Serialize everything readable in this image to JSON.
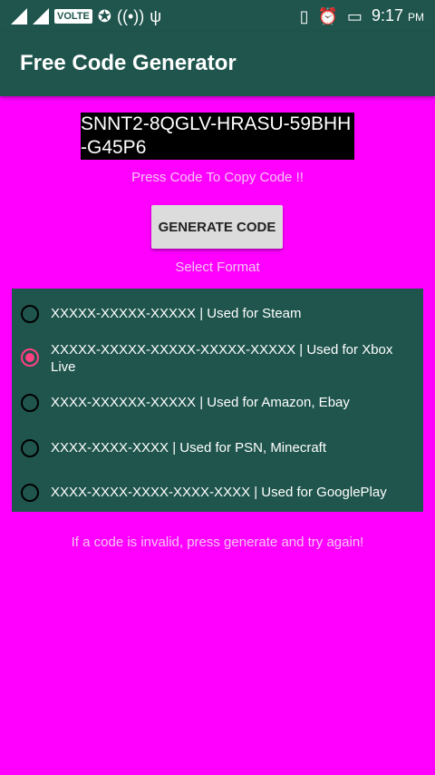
{
  "status_bar": {
    "volte": "VOLTE",
    "time": "9:17",
    "ampm": "PM",
    "icons": [
      "signal-icon",
      "signal-icon",
      "volte-icon",
      "messenger-icon",
      "hotspot-icon",
      "usb-icon",
      "vibrate-icon",
      "alarm-icon",
      "battery-icon"
    ]
  },
  "app": {
    "title": "Free Code Generator"
  },
  "code": {
    "value": "SNNT2-8QGLV-HRASU-59BHH-G45P6",
    "copy_hint": "Press Code To Copy Code !!"
  },
  "generate": {
    "label": "GENERATE CODE"
  },
  "format": {
    "label": "Select Format",
    "selected_index": 1,
    "options": [
      {
        "label": "XXXXX-XXXXX-XXXXX | Used for Steam"
      },
      {
        "label": "XXXXX-XXXXX-XXXXX-XXXXX-XXXXX | Used for Xbox Live"
      },
      {
        "label": "XXXX-XXXXXX-XXXXX | Used for Amazon, Ebay"
      },
      {
        "label": "XXXX-XXXX-XXXX | Used for PSN, Minecraft"
      },
      {
        "label": "XXXX-XXXX-XXXX-XXXX-XXXX | Used for GooglePlay"
      }
    ]
  },
  "footer": {
    "invalid_hint": "If a code is invalid, press generate and try again!"
  },
  "colors": {
    "background": "#ff00ff",
    "toolbar": "#1f554d",
    "accent": "#ff4081"
  }
}
